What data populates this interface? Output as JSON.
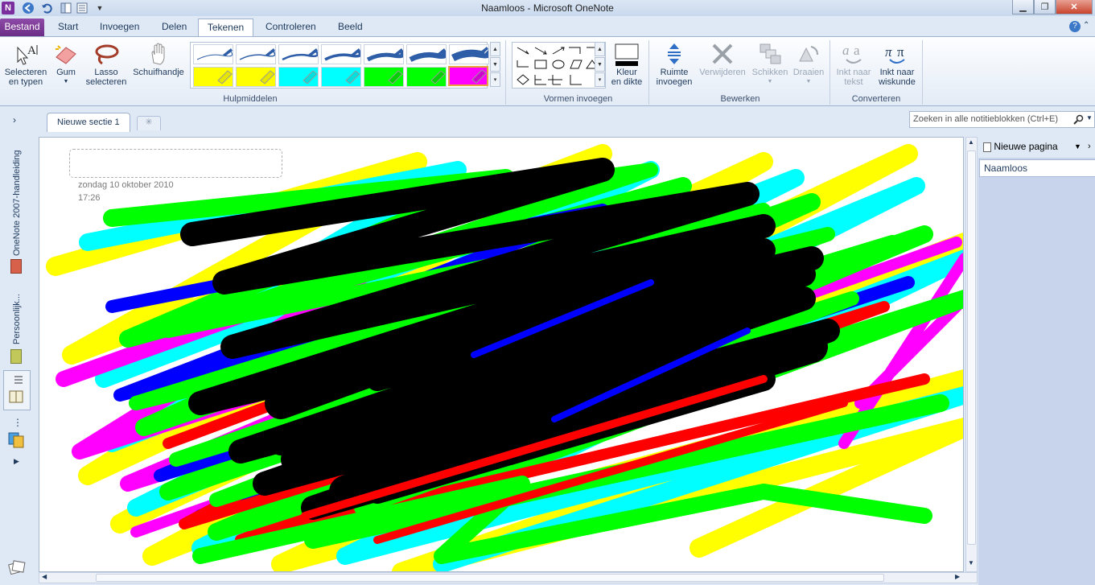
{
  "window": {
    "title": "Naamloos - Microsoft OneNote"
  },
  "tabs": [
    "Bestand",
    "Start",
    "Invoegen",
    "Delen",
    "Tekenen",
    "Controleren",
    "Beeld"
  ],
  "active_tab": "Tekenen",
  "ribbon": {
    "tools": {
      "select": "Selecteren en typen",
      "select_l1": "Selecteren",
      "select_l2": "en typen",
      "eraser": "Gum",
      "lasso_l1": "Lasso",
      "lasso_l2": "selecteren",
      "hand": "Schuifhandje"
    },
    "groups": {
      "tools": "Hulpmiddelen",
      "shapes": "Vormen invoegen",
      "edit": "Bewerken",
      "convert": "Converteren"
    },
    "color_l1": "Kleur",
    "color_l2": "en dikte",
    "space_l1": "Ruimte",
    "space_l2": "invoegen",
    "delete": "Verwijderen",
    "arrange": "Schikken",
    "rotate": "Draaien",
    "ink_text_l1": "Inkt naar",
    "ink_text_l2": "tekst",
    "ink_math_l1": "Inkt naar",
    "ink_math_l2": "wiskunde",
    "pen_colors": [
      "#2f5ea8",
      "#2f5ea8",
      "#2f5ea8",
      "#2f5ea8",
      "#2f5ea8",
      "#2f5ea8",
      "#2f5ea8",
      "#ffff00",
      "#ffff00",
      "#00ffff",
      "#00ffff",
      "#00ff00",
      "#00ff00",
      "#ff00ff"
    ]
  },
  "notebooks": {
    "items": [
      "OneNote 2007-handleiding",
      "Persoonlijk..."
    ]
  },
  "section_tab": "Nieuwe sectie 1",
  "search": {
    "placeholder": "Zoeken in alle notitieblokken (Ctrl+E)"
  },
  "page": {
    "date": "zondag 10 oktober 2010",
    "time": "17:26"
  },
  "pages_panel": {
    "new_page": "Nieuwe pagina",
    "pages": [
      "Naamloos"
    ]
  }
}
